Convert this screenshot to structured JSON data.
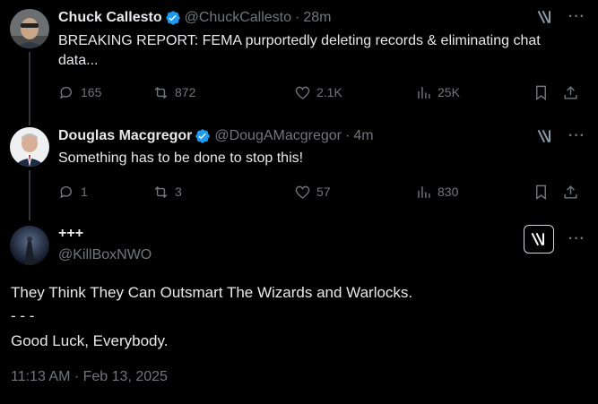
{
  "tweets": [
    {
      "name": "Chuck Callesto",
      "handle": "@ChuckCallesto",
      "time": "28m",
      "text": "BREAKING REPORT: FEMA purportedly deleting records & eliminating chat data...",
      "replies": "165",
      "retweets": "872",
      "likes": "2.1K",
      "views": "25K"
    },
    {
      "name": "Douglas Macgregor",
      "handle": "@DougAMacgregor",
      "time": "4m",
      "text": "Something has to be done to stop this!",
      "replies": "1",
      "retweets": "3",
      "likes": "57",
      "views": "830"
    }
  ],
  "main": {
    "name": "+++",
    "handle": "@KillBoxNWO",
    "line1": "They Think They Can Outsmart The Wizards and Warlocks.",
    "line2": "- - -",
    "line3": "Good Luck, Everybody.",
    "timestamp": "11:13 AM · Feb 13, 2025"
  },
  "separator": "·",
  "more_glyph": "···",
  "colors": {
    "background": "#000000",
    "text": "#e7e9ea",
    "muted": "#71767b",
    "verified": "#1d9bf0"
  },
  "icons": [
    "reply-icon",
    "retweet-icon",
    "like-icon",
    "views-icon",
    "bookmark-icon",
    "share-icon",
    "grok-icon",
    "more-icon",
    "verified-badge-icon"
  ]
}
